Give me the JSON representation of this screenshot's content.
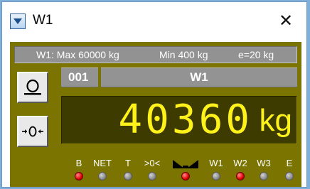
{
  "window": {
    "title": "W1",
    "close_glyph": "✕",
    "menu_icon": "window-menu-icon"
  },
  "scale": {
    "header": {
      "max": "W1: Max 60000 kg",
      "min": "Min 400 kg",
      "division": "e=20 kg"
    },
    "id_number": "001",
    "name": "W1",
    "weight": "40360",
    "unit": "kg",
    "buttons": [
      {
        "name": "zero-button",
        "icon": "scale-zero-icon"
      },
      {
        "name": "tare-button",
        "icon": "tare-center-icon"
      }
    ],
    "indicators": [
      {
        "label": "B",
        "on": true
      },
      {
        "label": "NET",
        "on": false
      },
      {
        "label": "T",
        "on": false
      },
      {
        "label": ">0<",
        "on": false
      },
      {
        "label": "",
        "icon": "motion-bowtie-icon",
        "on": true
      },
      {
        "label": "W1",
        "on": false
      },
      {
        "label": "W2",
        "on": true
      },
      {
        "label": "W3",
        "on": false
      },
      {
        "label": "E",
        "on": false
      }
    ],
    "colors": {
      "panel": "#7b7400",
      "display_bg": "#3d3b00",
      "digits": "#fff21a",
      "led_on": "#e00000",
      "led_off": "#9a9a9a"
    }
  }
}
